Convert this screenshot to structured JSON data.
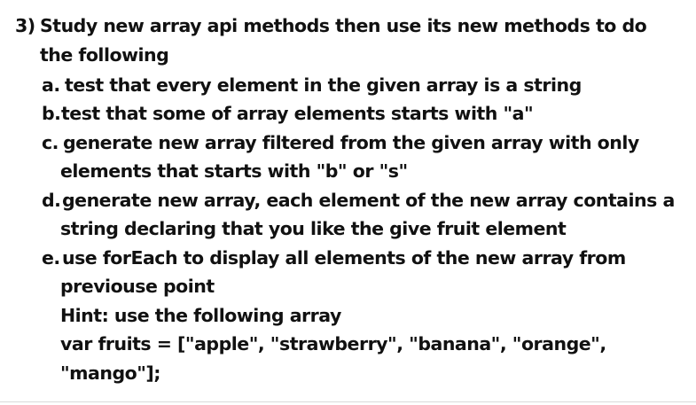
{
  "question": {
    "number": "3)",
    "title_line1": "Study new array api methods then use its new methods to do",
    "title_line2": "the following",
    "items": [
      {
        "marker": "a.",
        "lines": [
          "test that every element in the given array is a string"
        ]
      },
      {
        "marker": "b.",
        "lines": [
          "test that some of array elements starts with \"a\""
        ]
      },
      {
        "marker": "c.",
        "lines": [
          "generate new array filtered from the given array with only",
          "elements that starts with \"b\" or \"s\""
        ]
      },
      {
        "marker": "d.",
        "lines": [
          "generate new array, each element of the new array contains a",
          "string declaring that you like the give fruit element"
        ]
      },
      {
        "marker": "e.",
        "lines": [
          "use forEach to display all elements of the new array from",
          "previouse point"
        ]
      }
    ],
    "hint": "Hint: use the following array",
    "code_line1": "var fruits = [\"apple\", \"strawberry\", \"banana\", \"orange\",",
    "code_line2": "\"mango\"];"
  }
}
